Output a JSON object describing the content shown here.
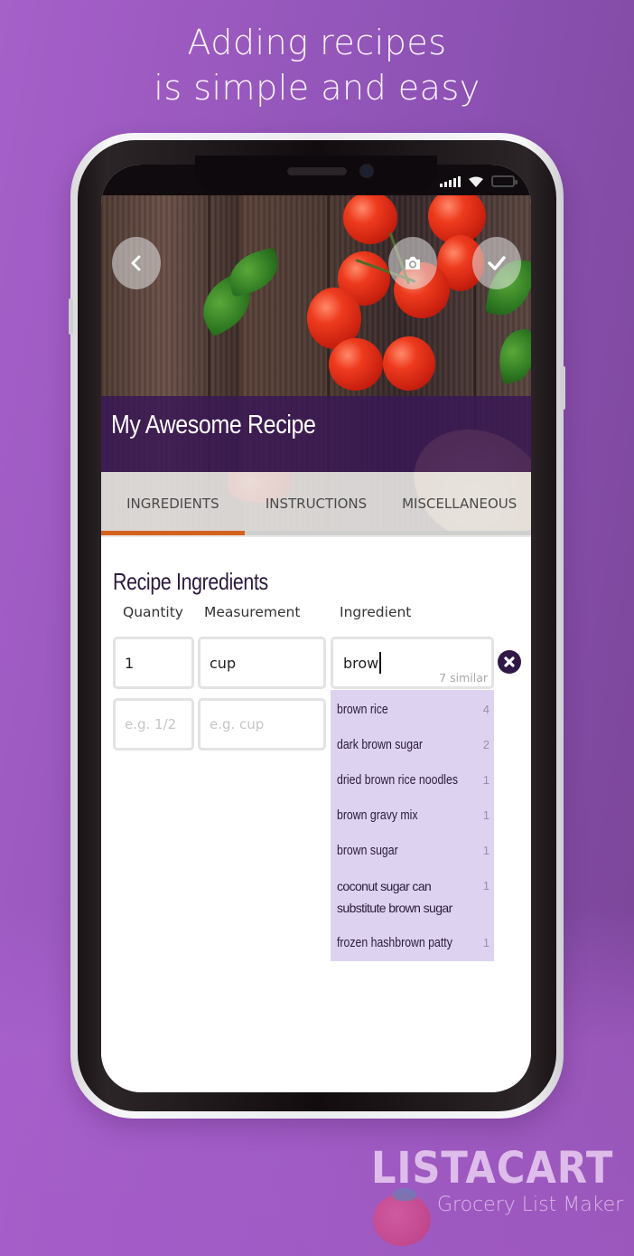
{
  "headline": {
    "line1": "Adding recipes",
    "line2": "is simple and easy"
  },
  "status_bar": {
    "icons": [
      "signal-icon",
      "wifi-icon",
      "battery-icon"
    ]
  },
  "header": {
    "back_icon": "chevron-left-icon",
    "camera_icon": "camera-icon",
    "save_icon": "checkmark-icon",
    "recipe_title": "My Awesome Recipe"
  },
  "tabs": [
    {
      "label": "INGREDIENTS",
      "active": true
    },
    {
      "label": "INSTRUCTIONS",
      "active": false
    },
    {
      "label": "MISCELLANEOUS",
      "active": false
    }
  ],
  "colors": {
    "accent": "#d4621e",
    "title_band": "#3a1955",
    "dark_purple": "#2f1848",
    "suggestion_bg": "#ddd3f0"
  },
  "ingredients": {
    "section_title": "Recipe Ingredients",
    "columns": {
      "quantity": "Quantity",
      "measurement": "Measurement",
      "ingredient": "Ingredient"
    },
    "rows": [
      {
        "quantity": "1",
        "measurement": "cup",
        "ingredient": "brow",
        "similar": "7 similar"
      }
    ],
    "new_row": {
      "quantity_placeholder": "e.g. 1/2",
      "measurement_placeholder": "e.g. cup"
    },
    "remove_icon": "close-circle-icon"
  },
  "suggestions": [
    {
      "name": "brown rice",
      "count": "4"
    },
    {
      "name": "dark brown sugar",
      "count": "2"
    },
    {
      "name": "dried brown rice noodles",
      "count": "1"
    },
    {
      "name": "brown gravy mix",
      "count": "1"
    },
    {
      "name": "brown sugar",
      "count": "1"
    },
    {
      "name": "coconut sugar can substitute brown sugar",
      "count": "1"
    },
    {
      "name": "frozen hashbrown patty",
      "count": "1"
    }
  ],
  "branding": {
    "name": "LISTACART",
    "tagline": "Grocery List Maker"
  }
}
